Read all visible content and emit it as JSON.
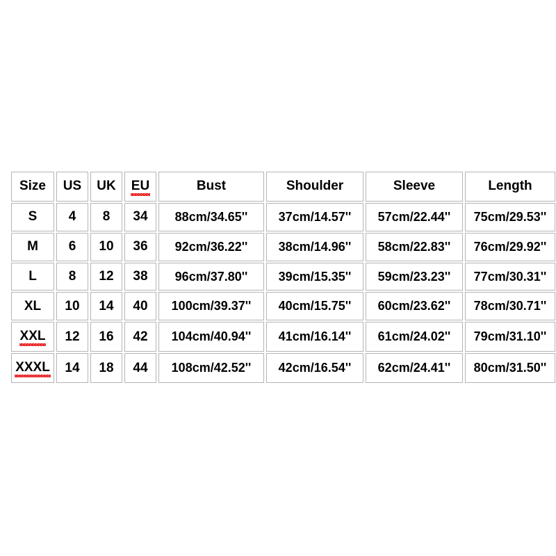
{
  "table": {
    "columns": [
      {
        "key": "size",
        "label": "Size",
        "spellcheck": false
      },
      {
        "key": "us",
        "label": "US",
        "spellcheck": false
      },
      {
        "key": "uk",
        "label": "UK",
        "spellcheck": false
      },
      {
        "key": "eu",
        "label": "EU",
        "spellcheck": true
      },
      {
        "key": "bust",
        "label": "Bust",
        "spellcheck": false
      },
      {
        "key": "shoulder",
        "label": "Shoulder",
        "spellcheck": false
      },
      {
        "key": "sleeve",
        "label": "Sleeve",
        "spellcheck": false
      },
      {
        "key": "length",
        "label": "Length",
        "spellcheck": false
      }
    ],
    "rows": [
      {
        "size": "S",
        "size_spellcheck": false,
        "us": "4",
        "uk": "8",
        "eu": "34",
        "bust": "88cm/34.65''",
        "shoulder": "37cm/14.57''",
        "sleeve": "57cm/22.44''",
        "length": "75cm/29.53''"
      },
      {
        "size": "M",
        "size_spellcheck": false,
        "us": "6",
        "uk": "10",
        "eu": "36",
        "bust": "92cm/36.22''",
        "shoulder": "38cm/14.96''",
        "sleeve": "58cm/22.83''",
        "length": "76cm/29.92''"
      },
      {
        "size": "L",
        "size_spellcheck": false,
        "us": "8",
        "uk": "12",
        "eu": "38",
        "bust": "96cm/37.80''",
        "shoulder": "39cm/15.35''",
        "sleeve": "59cm/23.23''",
        "length": "77cm/30.31''"
      },
      {
        "size": "XL",
        "size_spellcheck": false,
        "us": "10",
        "uk": "14",
        "eu": "40",
        "bust": "100cm/39.37''",
        "shoulder": "40cm/15.75''",
        "sleeve": "60cm/23.62''",
        "length": "78cm/30.71''"
      },
      {
        "size": "XXL",
        "size_spellcheck": true,
        "us": "12",
        "uk": "16",
        "eu": "42",
        "bust": "104cm/40.94''",
        "shoulder": "41cm/16.14''",
        "sleeve": "61cm/24.02''",
        "length": "79cm/31.10''"
      },
      {
        "size": "XXXL",
        "size_spellcheck": true,
        "us": "14",
        "uk": "18",
        "eu": "44",
        "bust": "108cm/42.52''",
        "shoulder": "42cm/16.54''",
        "sleeve": "62cm/24.41''",
        "length": "80cm/31.50''"
      }
    ]
  },
  "colors": {
    "background": "#ffffff",
    "cell_background": "#ffffff",
    "cell_border": "#b4b4b4",
    "text": "#000000",
    "spellcheck_underline": "#e81c1c"
  }
}
